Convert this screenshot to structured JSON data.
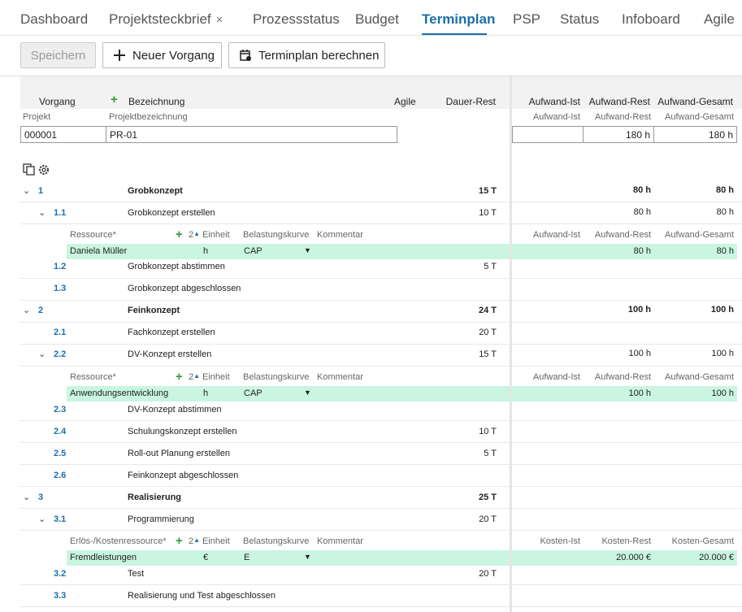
{
  "tabs": [
    "Dashboard",
    "Projektsteckbrief",
    "Prozessstatus",
    "Budget",
    "Terminplan",
    "PSP",
    "Status",
    "Infoboard",
    "Agile"
  ],
  "tab_close": "×",
  "toolbar": {
    "save": "Speichern",
    "new_task": "Neuer Vorgang",
    "calc": "Terminplan berechnen"
  },
  "header": {
    "vorgang": "Vorgang",
    "bezeichnung": "Bezeichnung",
    "agile": "Agile",
    "dauer": "Dauer-Rest",
    "ist": "Aufwand-Ist",
    "rest": "Aufwand-Rest",
    "gesamt": "Aufwand-Gesamt"
  },
  "project": {
    "label_projekt": "Projekt",
    "label_bez": "Projektbezeichnung",
    "id": "000001",
    "name": "PR-01",
    "ist_label": "Aufwand-Ist",
    "rest_label": "Aufwand-Rest",
    "gesamt_label": "Aufwand-Gesamt",
    "rest": "180 h",
    "gesamt": "180 h"
  },
  "res_headers": {
    "res": "Ressource*",
    "cost_res": "Erlös-/Kostenressource*",
    "sort": "2",
    "einheit": "Einheit",
    "kurve": "Belastungskurve",
    "kommentar": "Kommentar",
    "ist": "Aufwand-Ist",
    "rest": "Aufwand-Rest",
    "gesamt": "Aufwand-Gesamt",
    "k_ist": "Kosten-Ist",
    "k_rest": "Kosten-Rest",
    "k_gesamt": "Kosten-Gesamt"
  },
  "rows": [
    {
      "num": "1",
      "name": "Grobkonzept",
      "dauer": "15 T",
      "rest": "80 h",
      "gesamt": "80 h"
    },
    {
      "num": "1.1",
      "name": "Grobkonzept erstellen",
      "dauer": "10 T",
      "rest": "80 h",
      "gesamt": "80 h"
    },
    {
      "res": "Daniela Müller",
      "einheit": "h",
      "kurve": "CAP",
      "rest": "80 h",
      "gesamt": "80 h"
    },
    {
      "num": "1.2",
      "name": "Grobkonzept abstimmen",
      "dauer": "5 T"
    },
    {
      "num": "1.3",
      "name": "Grobkonzept abgeschlossen"
    },
    {
      "num": "2",
      "name": "Feinkonzept",
      "dauer": "24 T",
      "rest": "100 h",
      "gesamt": "100 h"
    },
    {
      "num": "2.1",
      "name": "Fachkonzept erstellen",
      "dauer": "20 T"
    },
    {
      "num": "2.2",
      "name": "DV-Konzept erstellen",
      "dauer": "15 T",
      "rest": "100 h",
      "gesamt": "100 h"
    },
    {
      "res": "Anwendungsentwicklung",
      "einheit": "h",
      "kurve": "CAP",
      "rest": "100 h",
      "gesamt": "100 h"
    },
    {
      "num": "2.3",
      "name": "DV-Konzept abstimmen"
    },
    {
      "num": "2.4",
      "name": "Schulungskonzept erstellen",
      "dauer": "10 T"
    },
    {
      "num": "2.5",
      "name": "Roll-out Planung erstellen",
      "dauer": "5 T"
    },
    {
      "num": "2.6",
      "name": "Feinkonzept abgeschlossen"
    },
    {
      "num": "3",
      "name": "Realisierung",
      "dauer": "25 T"
    },
    {
      "num": "3.1",
      "name": "Programmierung",
      "dauer": "20 T"
    },
    {
      "res": "Fremdleistungen",
      "einheit": "€",
      "kurve": "E",
      "rest": "20.000 €",
      "gesamt": "20.000 €"
    },
    {
      "num": "3.2",
      "name": "Test",
      "dauer": "20 T"
    },
    {
      "num": "3.3",
      "name": "Realisierung und Test abgeschlossen"
    }
  ]
}
